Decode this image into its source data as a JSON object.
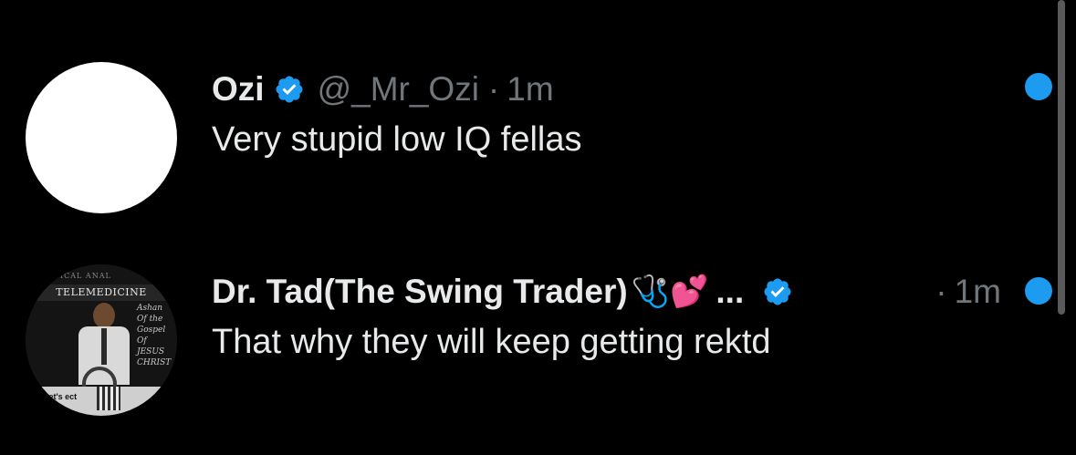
{
  "colors": {
    "background": "#000000",
    "primary_text": "#e7e9ea",
    "secondary_text": "#71767b",
    "accent": "#1d9bf0"
  },
  "notifications": [
    {
      "display_name": "Ozi",
      "verified": true,
      "handle": "@_Mr_Ozi",
      "separator": "·",
      "time": "1m",
      "text": "Very stupid low IQ fellas",
      "unread": true,
      "avatar_icon": "avatar-blank"
    },
    {
      "display_name": "Dr. Tad(The Swing Trader)",
      "name_emojis": "🩺💕",
      "truncation": "...",
      "verified": true,
      "separator": "·",
      "time": "1m",
      "text": "That why they will keep getting rektd",
      "unread": true,
      "avatar_icon": "avatar-photo",
      "avatar_text": {
        "top": "NICAL ANAL",
        "banner": "TELEMEDICINE",
        "script": "Ashan Of the Gospel Of JESUS CHRIST",
        "footer": "Let's ect On"
      }
    }
  ]
}
